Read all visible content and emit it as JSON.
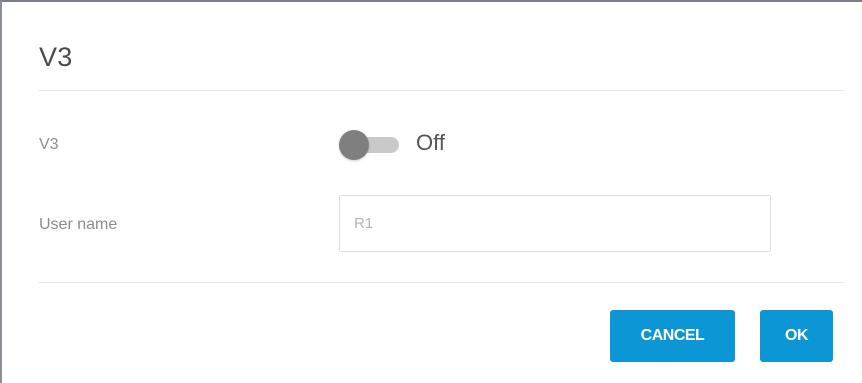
{
  "dialog": {
    "title": "V3",
    "v3_row": {
      "label": "V3",
      "toggle_state": "Off",
      "toggle_on": false
    },
    "username_row": {
      "label": "User name",
      "input_value": "",
      "input_placeholder": "R1"
    },
    "buttons": {
      "cancel_label": "CANCEL",
      "ok_label": "OK"
    },
    "colors": {
      "primary_button": "#0d96d6",
      "toggle_knob_off": "#7f7f7f",
      "toggle_track_off": "#c9c9c9"
    }
  }
}
